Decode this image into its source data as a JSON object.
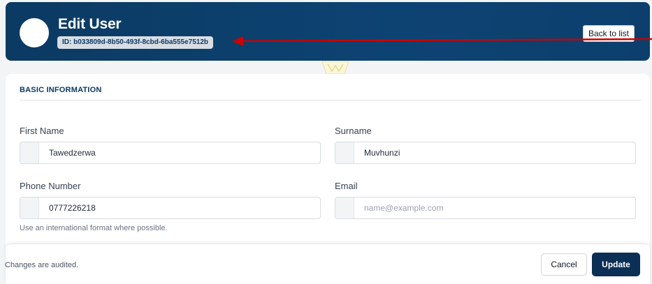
{
  "header": {
    "title": "Edit User",
    "id_badge": "ID: b033809d-8b50-493f-8cbd-6ba555e7512b",
    "back_label": "Back to list",
    "accent_color": "#0b3a63"
  },
  "annotation": {
    "arrow_color": "#cc0000"
  },
  "section": {
    "title": "BASIC INFORMATION"
  },
  "fields": {
    "first_name": {
      "label": "First Name",
      "value": "Tawedzerwa",
      "placeholder": ""
    },
    "surname": {
      "label": "Surname",
      "value": "Muvhunzi",
      "placeholder": ""
    },
    "phone": {
      "label": "Phone Number",
      "value": "0777226218",
      "placeholder": "",
      "hint": "Use an international format where possible."
    },
    "email": {
      "label": "Email",
      "value": "",
      "placeholder": "name@example.com"
    }
  },
  "footer": {
    "note": "Changes are audited.",
    "cancel_label": "Cancel",
    "update_label": "Update",
    "primary_color": "#0b2f55"
  }
}
